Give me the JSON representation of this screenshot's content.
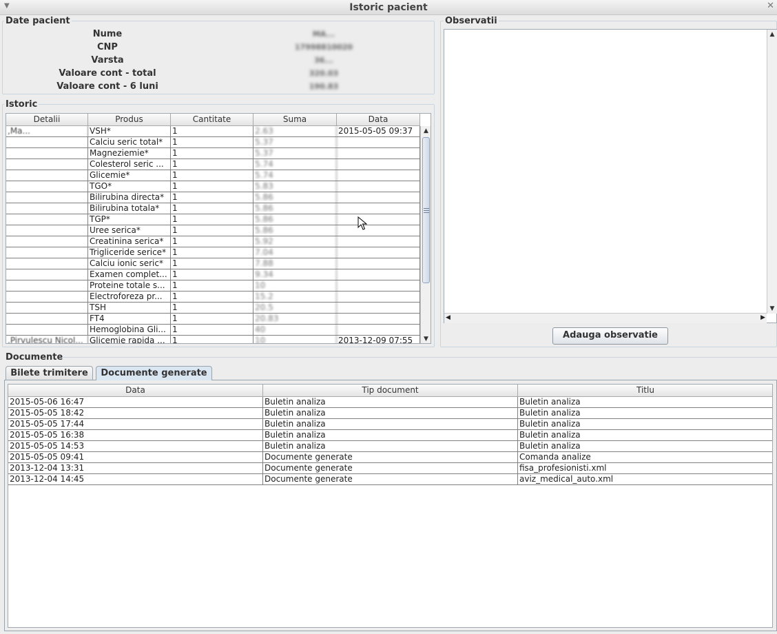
{
  "window": {
    "title": "Istoric pacient"
  },
  "patient": {
    "section_title": "Date pacient",
    "fields": [
      {
        "label": "Nume",
        "value": "MA..."
      },
      {
        "label": "CNP",
        "value": "17998810020"
      },
      {
        "label": "Varsta",
        "value": "36..."
      },
      {
        "label": "Valoare cont - total",
        "value": "320.03"
      },
      {
        "label": "Valoare cont - 6 luni",
        "value": "190.83"
      }
    ]
  },
  "istoric": {
    "section_title": "Istoric",
    "columns": [
      "Detalii",
      "Produs",
      "Cantitate",
      "Suma",
      "Data"
    ],
    "rows": [
      {
        "detalii": ",Ma...",
        "produs": "VSH*",
        "cantitate": "1",
        "suma": "2.63",
        "data": "2015-05-05 09:37"
      },
      {
        "detalii": "",
        "produs": "Calciu seric total*",
        "cantitate": "1",
        "suma": "5.37",
        "data": ""
      },
      {
        "detalii": "",
        "produs": "Magneziemie*",
        "cantitate": "1",
        "suma": "5.37",
        "data": ""
      },
      {
        "detalii": "",
        "produs": "Colesterol seric ...",
        "cantitate": "1",
        "suma": "5.74",
        "data": ""
      },
      {
        "detalii": "",
        "produs": "Glicemie*",
        "cantitate": "1",
        "suma": "5.74",
        "data": ""
      },
      {
        "detalii": "",
        "produs": "TGO*",
        "cantitate": "1",
        "suma": "5.83",
        "data": ""
      },
      {
        "detalii": "",
        "produs": "Bilirubina directa*",
        "cantitate": "1",
        "suma": "5.86",
        "data": ""
      },
      {
        "detalii": "",
        "produs": "Bilirubina totala*",
        "cantitate": "1",
        "suma": "5.86",
        "data": ""
      },
      {
        "detalii": "",
        "produs": "TGP*",
        "cantitate": "1",
        "suma": "5.86",
        "data": ""
      },
      {
        "detalii": "",
        "produs": "Uree serica*",
        "cantitate": "1",
        "suma": "5.86",
        "data": ""
      },
      {
        "detalii": "",
        "produs": "Creatinina serica*",
        "cantitate": "1",
        "suma": "5.92",
        "data": ""
      },
      {
        "detalii": "",
        "produs": "Trigliceride serice*",
        "cantitate": "1",
        "suma": "7.04",
        "data": ""
      },
      {
        "detalii": "",
        "produs": "Calciu ionic seric*",
        "cantitate": "1",
        "suma": "7.88",
        "data": ""
      },
      {
        "detalii": "",
        "produs": "Examen complet...",
        "cantitate": "1",
        "suma": "9.34",
        "data": ""
      },
      {
        "detalii": "",
        "produs": "Proteine totale s...",
        "cantitate": "1",
        "suma": "10",
        "data": ""
      },
      {
        "detalii": "",
        "produs": "Electroforeza pr...",
        "cantitate": "1",
        "suma": "15.2",
        "data": ""
      },
      {
        "detalii": "",
        "produs": "TSH",
        "cantitate": "1",
        "suma": "20.5",
        "data": ""
      },
      {
        "detalii": "",
        "produs": "FT4",
        "cantitate": "1",
        "suma": "20.83",
        "data": ""
      },
      {
        "detalii": "",
        "produs": "Hemoglobina Gli...",
        "cantitate": "1",
        "suma": "40",
        "data": ""
      },
      {
        "detalii": ",Pirvulescu Nicol...",
        "produs": "Glicemie rapida ...",
        "cantitate": "1",
        "suma": "10",
        "data": "2013-12-09 07:55"
      }
    ]
  },
  "observatii": {
    "section_title": "Observatii",
    "text": "",
    "add_button": "Adauga observatie"
  },
  "documente": {
    "section_title": "Documente",
    "tabs": [
      {
        "label": "Bilete trimitere",
        "active": false
      },
      {
        "label": "Documente generate",
        "active": true
      }
    ],
    "columns": [
      "Data",
      "Tip document",
      "Titlu"
    ],
    "rows": [
      {
        "data": "2015-05-06 16:47",
        "tip": "Buletin analiza",
        "titlu": "Buletin analiza"
      },
      {
        "data": "2015-05-05 18:42",
        "tip": "Buletin analiza",
        "titlu": "Buletin analiza"
      },
      {
        "data": "2015-05-05 17:44",
        "tip": "Buletin analiza",
        "titlu": "Buletin analiza"
      },
      {
        "data": "2015-05-05 16:38",
        "tip": "Buletin analiza",
        "titlu": "Buletin analiza"
      },
      {
        "data": "2015-05-05 14:53",
        "tip": "Buletin analiza",
        "titlu": "Buletin analiza"
      },
      {
        "data": "2015-05-05 09:41",
        "tip": "Documente generate",
        "titlu": "Comanda analize"
      },
      {
        "data": "2013-12-04 13:31",
        "tip": "Documente generate",
        "titlu": "fisa_profesionisti.xml"
      },
      {
        "data": "2013-12-04 14:45",
        "tip": "Documente generate",
        "titlu": "aviz_medical_auto.xml"
      }
    ]
  },
  "icons": {
    "window_menu": "chevron-down-icon",
    "window_close": "close-icon",
    "scroll_up": "arrow-up-icon",
    "scroll_down": "arrow-down-icon",
    "scroll_left": "arrow-left-icon",
    "scroll_right": "arrow-right-icon",
    "cursor": "mouse-pointer-icon"
  }
}
